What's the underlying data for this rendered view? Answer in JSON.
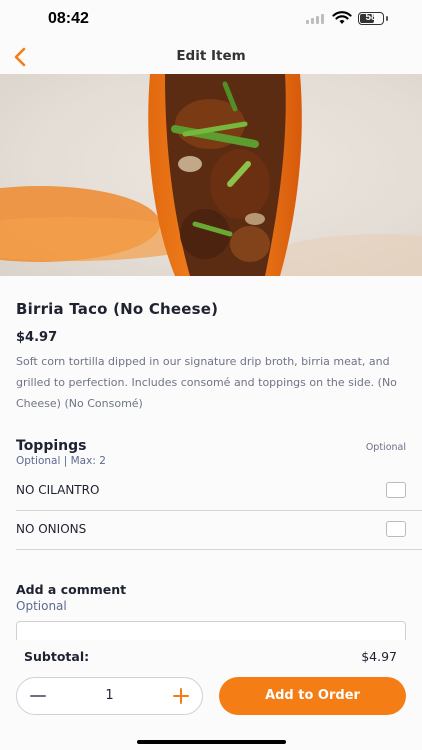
{
  "status_bar": {
    "time": "08:42",
    "battery": "58"
  },
  "nav": {
    "title": "Edit Item"
  },
  "item": {
    "name": "Birria Taco (No Cheese)",
    "price": "$4.97",
    "description": "Soft corn tortilla dipped in our signature drip broth, birria meat, and grilled to perfection. Includes consomé and toppings on the side. (No Cheese) (No Consomé)"
  },
  "toppings": {
    "title": "Toppings",
    "subtitle": "Optional | Max: 2",
    "badge": "Optional",
    "options": [
      {
        "label": "NO CILANTRO",
        "checked": false
      },
      {
        "label": "NO ONIONS",
        "checked": false
      }
    ]
  },
  "comment": {
    "title": "Add a comment",
    "subtitle": "Optional",
    "value": "",
    "placeholder": ""
  },
  "footer": {
    "subtotal_label": "Subtotal:",
    "subtotal_value": "$4.97",
    "quantity": "1",
    "add_label": "Add to Order"
  },
  "colors": {
    "accent": "#f47d16",
    "text": "#1f2230",
    "muted": "#6f7487"
  }
}
